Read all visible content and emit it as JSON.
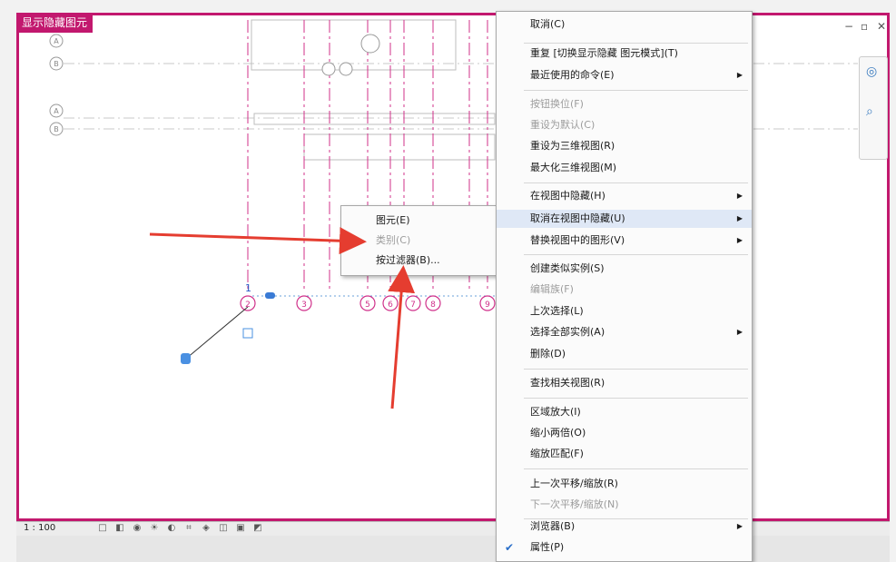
{
  "window": {
    "title": "显示隐藏图元",
    "controls": [
      "−",
      "▫",
      "✕"
    ]
  },
  "canvas": {
    "grid_bubbles_top": [
      "1",
      "1",
      "1"
    ],
    "grid_bubbles_left": [
      "B",
      "A"
    ],
    "grid_bubbles_row": [
      "2",
      "3",
      "5",
      "6",
      "7",
      "8",
      "9"
    ],
    "grid_bubble_selected": "1"
  },
  "statusbar": {
    "scale": "1 : 100",
    "icons": [
      "view-cube-icon",
      "detail-icon",
      "visual-style-icon",
      "sun-icon",
      "shadow-icon",
      "crop-icon",
      "render-icon",
      "hide-icon",
      "reveal-icon",
      "temp-icon"
    ]
  },
  "context_menu": {
    "items": [
      {
        "label": "取消(C)",
        "disabled": false
      },
      {
        "label": "重复 [切换显示隐藏 图元模式](T)",
        "disabled": false
      },
      {
        "label": "最近使用的命令(E)",
        "disabled": false,
        "submenu": true
      },
      {
        "label": "按钮换位(F)",
        "disabled": true
      },
      {
        "label": "重设为默认(C)",
        "disabled": true
      },
      {
        "label": "重设为三维视图(R)",
        "disabled": false
      },
      {
        "label": "最大化三维视图(M)",
        "disabled": false
      },
      {
        "label": "在视图中隐藏(H)",
        "disabled": false,
        "submenu": true
      },
      {
        "label": "取消在视图中隐藏(U)",
        "disabled": false,
        "submenu": true,
        "highlight": true
      },
      {
        "label": "替换视图中的图形(V)",
        "disabled": false,
        "submenu": true
      },
      {
        "label": "创建类似实例(S)",
        "disabled": false
      },
      {
        "label": "编辑族(F)",
        "disabled": true
      },
      {
        "label": "上次选择(L)",
        "disabled": false
      },
      {
        "label": "选择全部实例(A)",
        "disabled": false,
        "submenu": true
      },
      {
        "label": "删除(D)",
        "disabled": false
      },
      {
        "label": "查找相关视图(R)",
        "disabled": false
      },
      {
        "label": "区域放大(I)",
        "disabled": false
      },
      {
        "label": "缩小两倍(O)",
        "disabled": false
      },
      {
        "label": "缩放匹配(F)",
        "disabled": false
      },
      {
        "label": "上一次平移/缩放(R)",
        "disabled": false
      },
      {
        "label": "下一次平移/缩放(N)",
        "disabled": true
      },
      {
        "label": "浏览器(B)",
        "disabled": false,
        "submenu": true
      },
      {
        "label": "属性(P)",
        "disabled": false,
        "checked": true
      }
    ]
  },
  "sub_menu": {
    "items": [
      {
        "label": "图元(E)",
        "disabled": false
      },
      {
        "label": "类别(C)",
        "disabled": true
      },
      {
        "label": "按过滤器(B)...",
        "disabled": false
      }
    ]
  },
  "colors": {
    "accent": "#c2186e",
    "grid_line": "#d0308a",
    "arrow": "#e53d30",
    "highlight": "#dfe8f6"
  }
}
